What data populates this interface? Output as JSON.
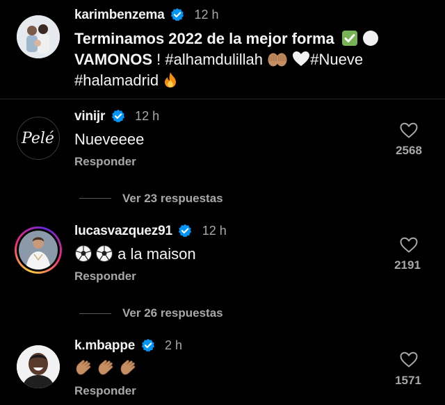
{
  "post": {
    "username": "karimbenzema",
    "time": "12 h",
    "caption_line1": "Terminamos 2022 de la mejor forma",
    "caption_line2_bold": "VAMONOS",
    "caption_line2_rest": " ! #alhamdulillah",
    "caption_line2_tag": "#Nueve",
    "caption_line3": "#halamadrid"
  },
  "comments": [
    {
      "username": "vinijr",
      "time": "12 h",
      "text": "Nueveeee",
      "reply_label": "Responder",
      "likes": "2568",
      "avatar_text": "Pelé",
      "view_replies": "Ver 23 respuestas"
    },
    {
      "username": "lucasvazquez91",
      "time": "12 h",
      "text": " a la maison",
      "reply_label": "Responder",
      "likes": "2191",
      "view_replies": "Ver 26 respuestas"
    },
    {
      "username": "k.mbappe",
      "time": "2 h",
      "text": "",
      "reply_label": "Responder",
      "likes": "1571"
    }
  ],
  "colors": {
    "verified": "#0095f6",
    "story_ring_start": "#f9ce34",
    "story_ring_mid": "#ee2a7b",
    "story_ring_end": "#6228d7"
  },
  "icons": [
    "verified-badge-icon",
    "check-mark-emoji",
    "white-circle-emoji",
    "hands-emoji",
    "white-heart-emoji",
    "fire-emoji",
    "soccer-ball-emoji",
    "clapping-hands-emoji",
    "heart-outline-icon"
  ]
}
